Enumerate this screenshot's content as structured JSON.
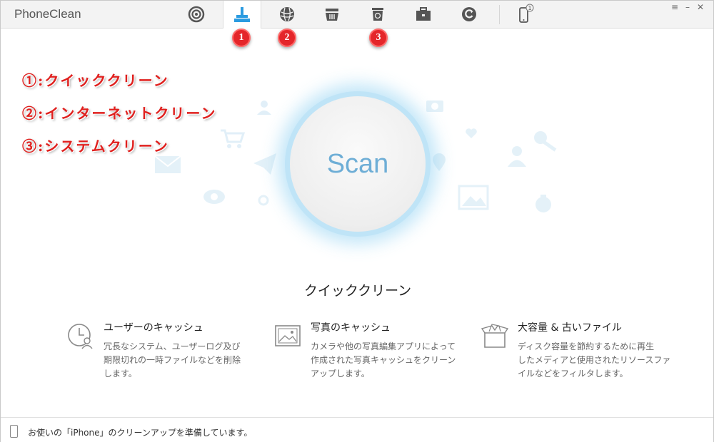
{
  "app": {
    "title": "PhoneClean"
  },
  "tabs": [
    {
      "icon": "signal-icon"
    },
    {
      "icon": "broom-icon",
      "active": true
    },
    {
      "icon": "globe-icon"
    },
    {
      "icon": "basket-icon"
    },
    {
      "icon": "trash-icon"
    },
    {
      "icon": "toolbox-icon"
    },
    {
      "icon": "restore-icon"
    },
    {
      "icon": "iphone-icon",
      "count": "1"
    }
  ],
  "window_controls": {
    "menu": "≡",
    "minimize": "–",
    "close": "✕"
  },
  "badges": [
    "1",
    "2",
    "3"
  ],
  "annotations": [
    "①:クイッククリーン",
    "②:インターネットクリーン",
    "③:システムクリーン"
  ],
  "scan": {
    "label": "Scan"
  },
  "mode_title": "クイッククリーン",
  "features": [
    {
      "icon": "clock-user-icon",
      "title": "ユーザーのキャッシュ",
      "desc": [
        "冗長なシステム、ユーザーログ及び",
        "期限切れの一時ファイルなどを削除",
        "します。"
      ]
    },
    {
      "icon": "photo-icon",
      "title": "写真のキャッシュ",
      "desc": [
        "カメラや他の写真編集アプリによって",
        "作成された写真キャッシュをクリーン",
        "アップします。"
      ]
    },
    {
      "icon": "box-icon",
      "title": "大容量 & 古いファイル",
      "desc": [
        "ディスク容量を節約するために再生",
        "したメディアと使用されたリソースファ",
        "イルなどをフィルタします。"
      ]
    }
  ],
  "status": {
    "text": "お使いの「iPhone」のクリーンアップを準備しています。"
  },
  "colors": {
    "accent": "#2b9be0",
    "badge": "#e4262a",
    "annotation": "#e0201e",
    "scan_text": "#6eaed6"
  }
}
